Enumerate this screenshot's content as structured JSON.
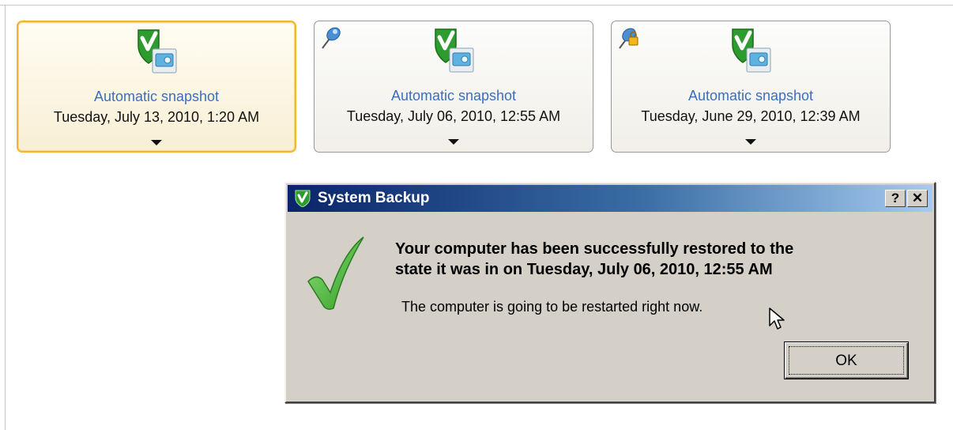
{
  "snapshots": [
    {
      "title": "Automatic snapshot",
      "date": "Tuesday, July 13, 2010, 1:20 AM",
      "selected": true,
      "badge": ""
    },
    {
      "title": "Automatic snapshot",
      "date": "Tuesday, July 06, 2010, 12:55 AM",
      "selected": false,
      "badge": "pin-icon"
    },
    {
      "title": "Automatic snapshot",
      "date": "Tuesday, June 29, 2010, 12:39 AM",
      "selected": false,
      "badge": "locked-pin-icon"
    }
  ],
  "dialog": {
    "title": "System Backup",
    "help_label": "?",
    "close_label": "✕",
    "message_line1": "Your computer has been successfully restored to the",
    "message_line2": "state it was in on Tuesday, July 06, 2010, 12:55 AM",
    "submessage": "The computer is going to be restarted right now.",
    "ok_label": "OK"
  },
  "colors": {
    "accent_selected": "#f5b432",
    "link_blue": "#3a6fbf",
    "titlebar_start": "#0a246a",
    "titlebar_end": "#a6caf0",
    "check_green": "#3dae2b"
  }
}
